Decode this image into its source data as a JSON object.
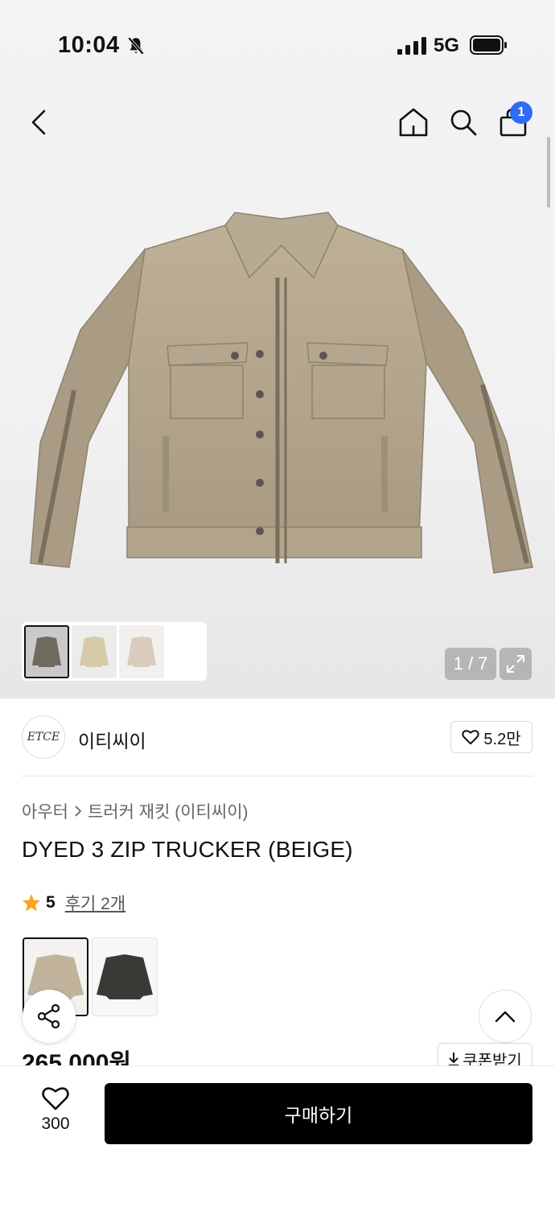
{
  "status_bar": {
    "time": "10:04",
    "network": "5G",
    "icons": [
      "bell-slash-icon",
      "signal-icon",
      "battery-icon"
    ]
  },
  "nav": {
    "icons": [
      "chevron-left-icon",
      "home-icon",
      "search-icon",
      "shopping-bag-icon"
    ],
    "cart_badge": "1"
  },
  "gallery": {
    "counter": "1 / 7",
    "thumbnails": 3,
    "expand_icon": "expand-icon"
  },
  "brand": {
    "logo_text": "ETCE",
    "name": "이티씨이",
    "likes": "5.2만",
    "like_icon": "heart-outline-icon"
  },
  "product": {
    "breadcrumb": [
      "아우터",
      "트러커 재킷 (이티씨이)"
    ],
    "title": "DYED 3 ZIP TRUCKER (BEIGE)",
    "rating": "5",
    "reviews": "후기 2개",
    "price": "265,000원",
    "coupon": "쿠폰받기",
    "colors": [
      "beige",
      "charcoal"
    ]
  },
  "bottom_bar": {
    "wish_count": "300",
    "buy_label": "구매하기"
  },
  "colors": {
    "accent_badge": "#2f6bf5",
    "buy_button": "#000000",
    "star": "#f5a623",
    "jacket_beige": "#b5a78f"
  }
}
